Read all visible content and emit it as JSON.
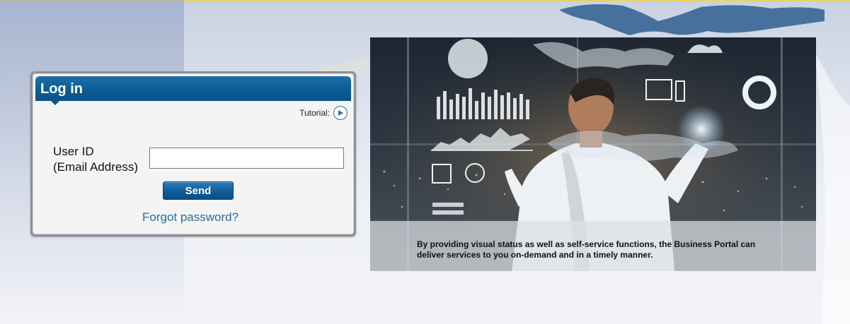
{
  "login": {
    "title": "Log in",
    "tutorial_label": "Tutorial:",
    "user_id_label_line1": "User ID",
    "user_id_label_line2": "(Email Address)",
    "user_id_value": "",
    "send_label": "Send",
    "forgot_label": "Forgot password?"
  },
  "hero": {
    "caption_line1": "By providing visual status as well as self-service functions, the Business Portal can",
    "caption_line2": "deliver services to you on-demand and in a timely manner."
  },
  "icons": {
    "tutorial": "play-icon"
  },
  "colors": {
    "header_blue": "#0d5e97",
    "link": "#2c6e95",
    "button": "#0f5d9a"
  }
}
